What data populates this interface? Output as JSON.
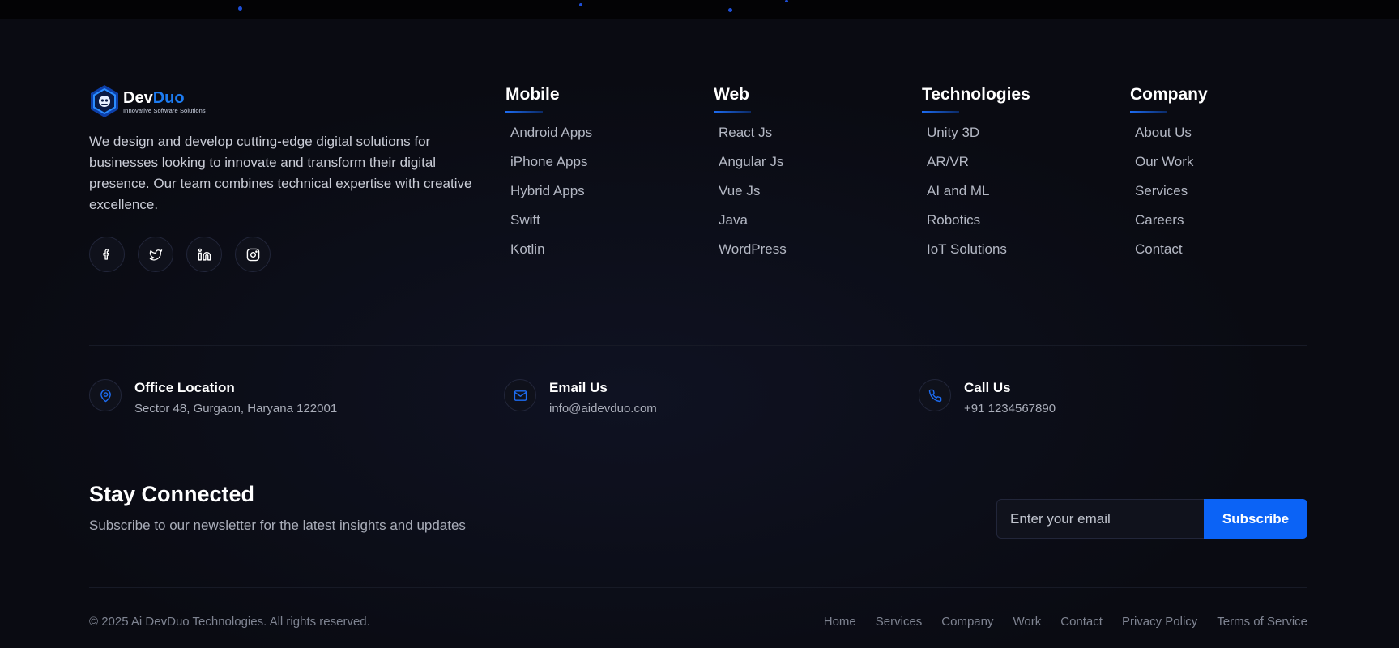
{
  "brand": {
    "name_part1": "Dev",
    "name_part2": "Duo",
    "tagline": "Innovative Software Solutions",
    "description": "We design and develop cutting-edge digital solutions for businesses looking to innovate and transform their digital presence. Our team combines technical expertise with creative excellence.",
    "socials": [
      "facebook-icon",
      "twitter-icon",
      "linkedin-icon",
      "instagram-icon"
    ]
  },
  "columns": [
    {
      "title": "Mobile",
      "items": [
        "Android Apps",
        "iPhone Apps",
        "Hybrid Apps",
        "Swift",
        "Kotlin"
      ]
    },
    {
      "title": "Web",
      "items": [
        "React Js",
        "Angular Js",
        "Vue Js",
        "Java",
        "WordPress"
      ]
    },
    {
      "title": "Technologies",
      "items": [
        "Unity 3D",
        "AR/VR",
        "AI and ML",
        "Robotics",
        "IoT Solutions"
      ]
    },
    {
      "title": "Company",
      "items": [
        "About Us",
        "Our Work",
        "Services",
        "Careers",
        "Contact"
      ]
    }
  ],
  "contact": {
    "location": {
      "title": "Office Location",
      "value": "Sector 48, Gurgaon, Haryana 122001",
      "icon": "map-pin-icon"
    },
    "email": {
      "title": "Email Us",
      "value": "info@aidevduo.com",
      "icon": "mail-icon"
    },
    "phone": {
      "title": "Call Us",
      "value": "+91 1234567890",
      "icon": "phone-icon"
    }
  },
  "newsletter": {
    "title": "Stay Connected",
    "subtitle": "Subscribe to our newsletter for the latest insights and updates",
    "placeholder": "Enter your email",
    "button": "Subscribe"
  },
  "bottom": {
    "copyright": "© 2025 Ai DevDuo Technologies. All rights reserved.",
    "links": [
      "Home",
      "Services",
      "Company",
      "Work",
      "Contact",
      "Privacy Policy",
      "Terms of Service"
    ]
  },
  "colors": {
    "accent": "#0b63f6",
    "background": "#0a0b12",
    "brand_blue": "#1d7cf2"
  }
}
